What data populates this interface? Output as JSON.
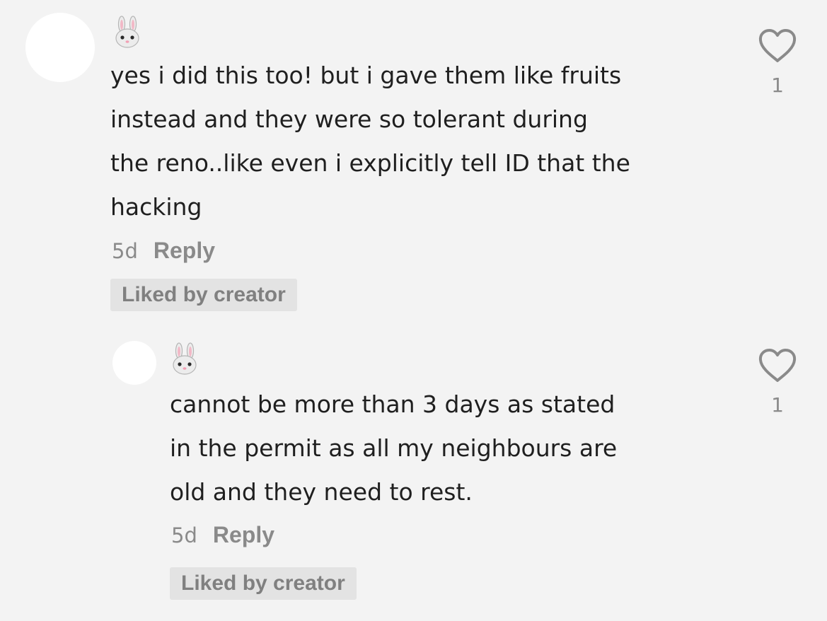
{
  "comments": [
    {
      "user_emoji": "rabbit-face-emoji",
      "text_lines": [
        "yes i did this too! but i gave them like fruits",
        "instead and they were so tolerant during",
        "the reno..like even i explicitly tell ID that the",
        "hacking"
      ],
      "time": "5d",
      "reply_label": "Reply",
      "liked_badge": "Liked by creator",
      "like_icon": "heart-outline-icon",
      "like_count": "1"
    },
    {
      "user_emoji": "rabbit-face-emoji",
      "text_lines": [
        "cannot be more than 3 days as stated",
        "in the permit as all my neighbours are",
        "old and they need to rest."
      ],
      "time": "5d",
      "reply_label": "Reply",
      "liked_badge": "Liked by creator",
      "like_icon": "heart-outline-icon",
      "like_count": "1"
    }
  ],
  "colors": {
    "background": "#f3f3f3",
    "avatar": "#ffffff",
    "text": "#1f1f1f",
    "meta": "#8a8a8a",
    "badge_bg": "#e3e3e3",
    "heart_stroke": "#8a8a8a"
  }
}
